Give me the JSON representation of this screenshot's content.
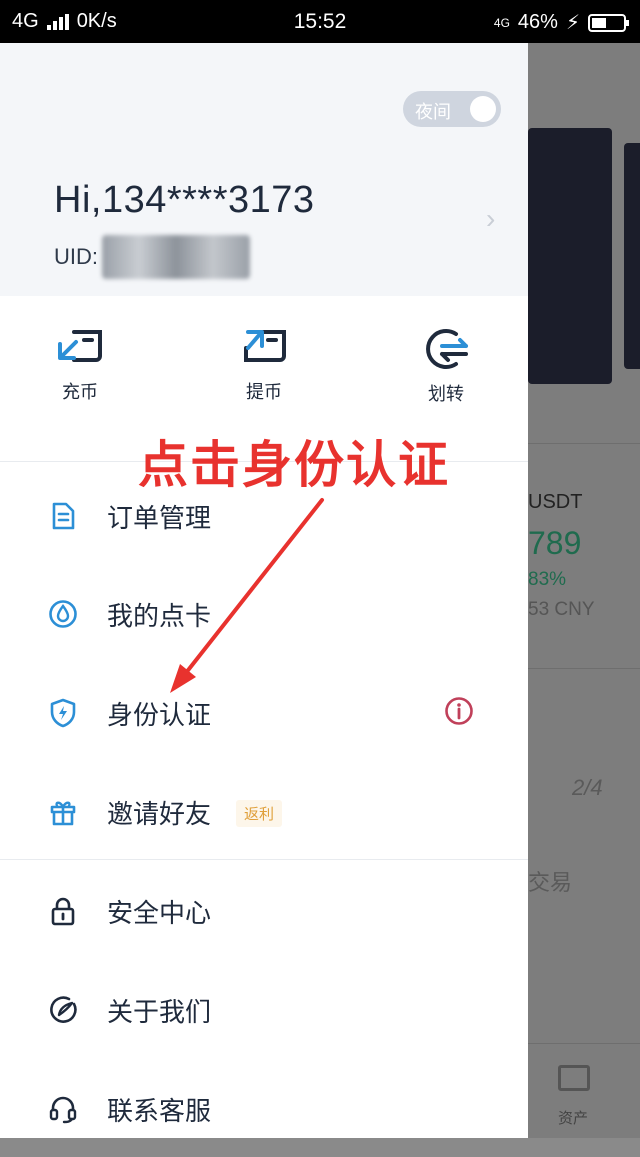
{
  "status_bar": {
    "network": "4G",
    "speed": "0K/s",
    "time": "15:52",
    "network_right": "4G",
    "battery": "46%",
    "battery_fraction": 0.46
  },
  "drawer": {
    "night_toggle_label": "夜间",
    "greeting": "Hi,134****3173",
    "uid_label": "UID:",
    "actions": [
      {
        "label": "充币",
        "icon": "deposit-icon"
      },
      {
        "label": "提币",
        "icon": "withdraw-icon"
      },
      {
        "label": "划转",
        "icon": "transfer-icon"
      }
    ],
    "menu": [
      {
        "label": "订单管理",
        "icon": "order-icon"
      },
      {
        "label": "我的点卡",
        "icon": "point-card-icon"
      },
      {
        "label": "身份认证",
        "icon": "shield-icon",
        "alert_icon": "info-icon"
      },
      {
        "label": "邀请好友",
        "icon": "gift-icon",
        "badge": "返利"
      },
      {
        "label": "安全中心",
        "icon": "lock-icon"
      },
      {
        "label": "关于我们",
        "icon": "about-icon"
      },
      {
        "label": "联系客服",
        "icon": "headset-icon"
      }
    ]
  },
  "background_app": {
    "pair": "USDT",
    "price": "789",
    "change": "83%",
    "cny": "53 CNY",
    "page_indicator": "2/4",
    "trade_label": "交易",
    "tab_label": "资产"
  },
  "annotation": {
    "text": "点击身份认证",
    "color": "#e8322e"
  },
  "colors": {
    "accent": "#2c8fd6",
    "text_primary": "#1f2a3c",
    "alert": "#c0405a"
  }
}
